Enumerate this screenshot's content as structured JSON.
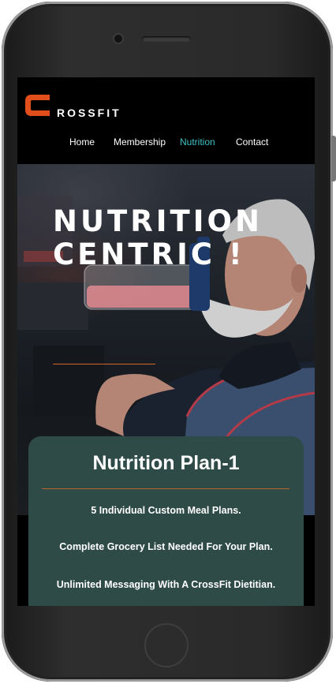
{
  "brand": {
    "logo_letter": "C",
    "name": "ROSSFIT",
    "accent_color": "#e24e1b"
  },
  "nav": {
    "items": [
      {
        "label": "Home",
        "active": false
      },
      {
        "label": "Membership",
        "active": false
      },
      {
        "label": "Nutrition",
        "active": true
      },
      {
        "label": "Contact",
        "active": false
      }
    ],
    "active_color": "#3fc3c3"
  },
  "hero": {
    "title_line1": "NUTRITION",
    "title_line2": "CENTRIC !"
  },
  "plan": {
    "title": "Nutrition Plan-1",
    "features": [
      "5 Individual Custom Meal Plans.",
      "Complete Grocery List Needed For Your Plan.",
      "Unlimited Messaging With A CrossFit Dietitian."
    ],
    "card_color": "#2f4b48"
  }
}
